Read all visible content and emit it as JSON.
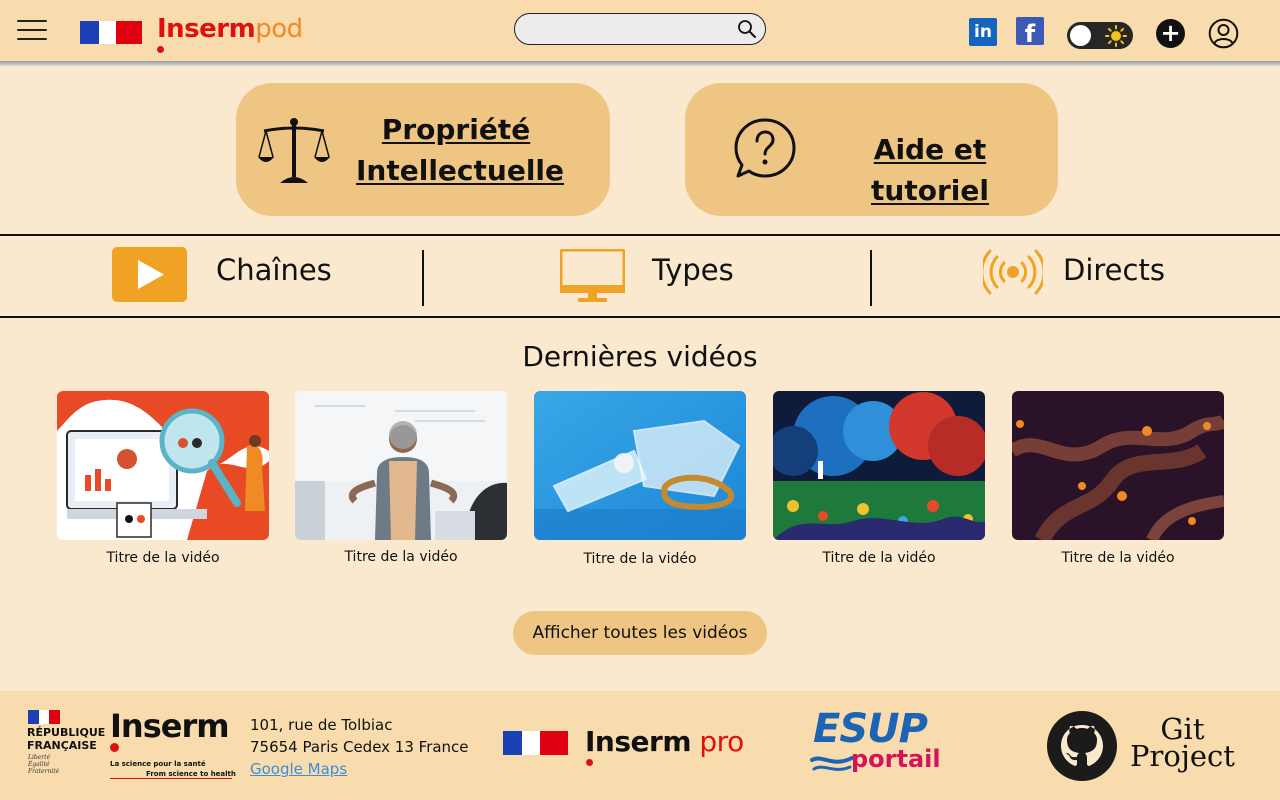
{
  "header": {
    "brand_main": "Inserm",
    "brand_sub": "pod",
    "search_placeholder": "",
    "social_linkedin": "in",
    "social_facebook": "f"
  },
  "cards": [
    {
      "label": "Propriété Intellectuelle",
      "line1": "Propriété",
      "line2": "Intellectuelle",
      "icon": "scales-icon"
    },
    {
      "label": "Aide et tutoriel",
      "icon": "question-bubble-icon"
    }
  ],
  "nav": [
    {
      "label": "Chaînes",
      "icon": "play-icon"
    },
    {
      "label": "Types",
      "icon": "monitor-icon"
    },
    {
      "label": "Directs",
      "icon": "broadcast-icon"
    }
  ],
  "videos": {
    "title": "Dernières vidéos",
    "items": [
      {
        "title": "Titre de la vidéo"
      },
      {
        "title": "Titre de la vidéo"
      },
      {
        "title": "Titre de la vidéo"
      },
      {
        "title": "Titre de la vidéo"
      },
      {
        "title": "Titre de la vidéo"
      }
    ],
    "show_all": "Afficher toutes les vidéos"
  },
  "footer": {
    "rf_line1": "RÉPUBLIQUE",
    "rf_line2": "FRANÇAISE",
    "rf_motto1": "Liberté",
    "rf_motto2": "Égalité",
    "rf_motto3": "Fraternité",
    "inserm": "Inserm",
    "tagline_fr": "La science pour la santé",
    "tagline_en": "From science to health",
    "address_line1": "101, rue de Tolbiac",
    "address_line2": "75654 Paris Cedex 13 France",
    "maps_link": "Google Maps",
    "pro_main": "Inserm",
    "pro_sub": "pro",
    "esup": "esup",
    "portail": "portail",
    "git_line1": "Git",
    "git_line2": "Project"
  },
  "colors": {
    "page_bg": "#fbe9cf",
    "header_bg": "#f9dcae",
    "card_bg": "#eec583",
    "accent_orange": "#f0a224",
    "inserm_red": "#e01010"
  }
}
